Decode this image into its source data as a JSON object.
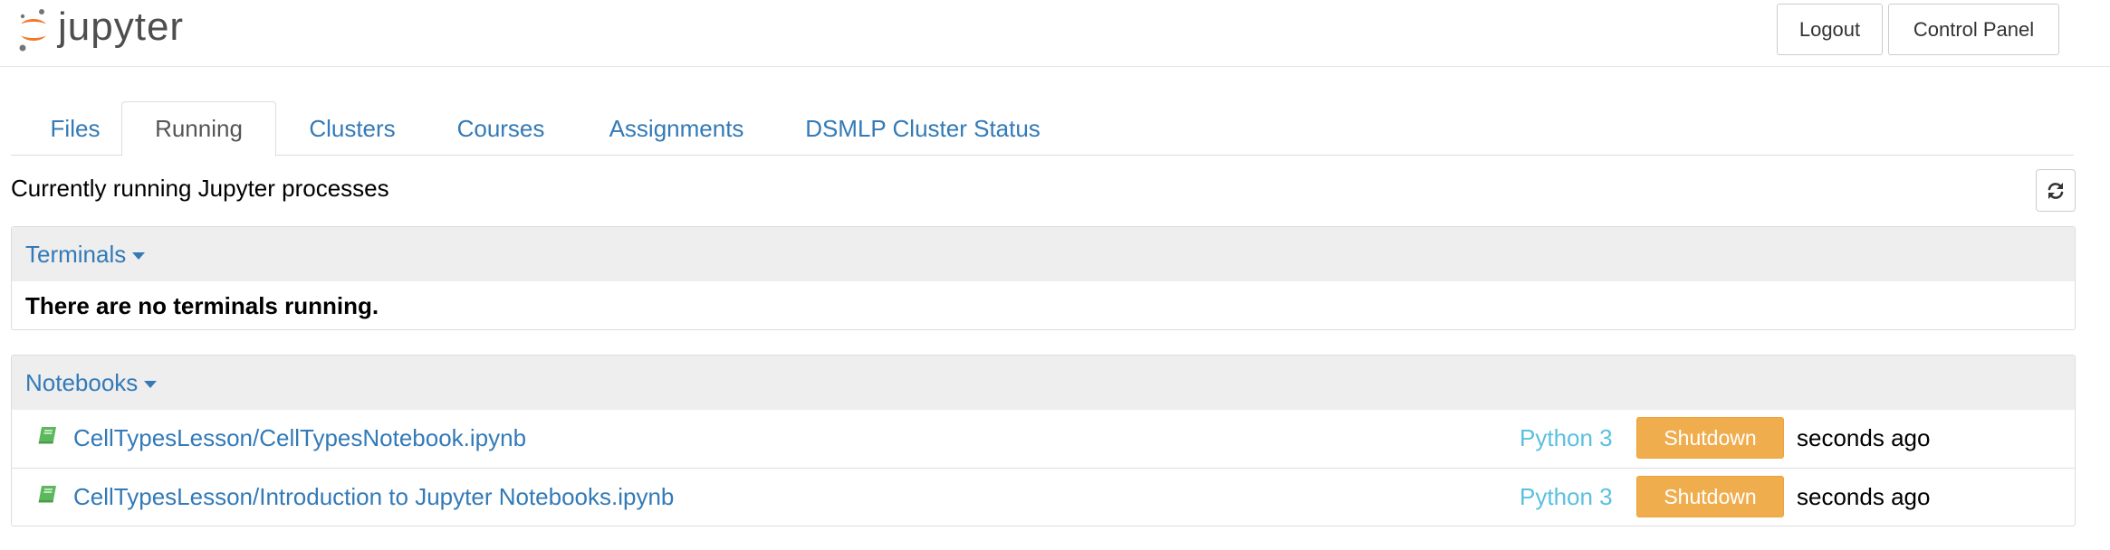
{
  "header": {
    "logo_text": "jupyter",
    "logout_label": "Logout",
    "control_panel_label": "Control Panel",
    "logo_color_orange": "#f37726",
    "logo_color_grey": "#767677"
  },
  "tabs": [
    {
      "label": "Files",
      "active": false
    },
    {
      "label": "Running",
      "active": true
    },
    {
      "label": "Clusters",
      "active": false
    },
    {
      "label": "Courses",
      "active": false
    },
    {
      "label": "Assignments",
      "active": false
    },
    {
      "label": "DSMLP Cluster Status",
      "active": false
    }
  ],
  "running": {
    "title": "Currently running Jupyter processes",
    "refresh_icon": "refresh-icon"
  },
  "terminals": {
    "heading": "Terminals",
    "empty_message": "There are no terminals running."
  },
  "notebooks": {
    "heading": "Notebooks",
    "items": [
      {
        "name": "CellTypesLesson/CellTypesNotebook.ipynb",
        "kernel": "Python 3",
        "shutdown_label": "Shutdown",
        "time": "seconds ago"
      },
      {
        "name": "CellTypesLesson/Introduction to Jupyter Notebooks.ipynb",
        "kernel": "Python 3",
        "shutdown_label": "Shutdown",
        "time": "seconds ago"
      }
    ]
  },
  "colors": {
    "link": "#337ab7",
    "kernel": "#5bc0de",
    "warning": "#f0ad4e",
    "notebook_icon": "#5cb85c"
  }
}
